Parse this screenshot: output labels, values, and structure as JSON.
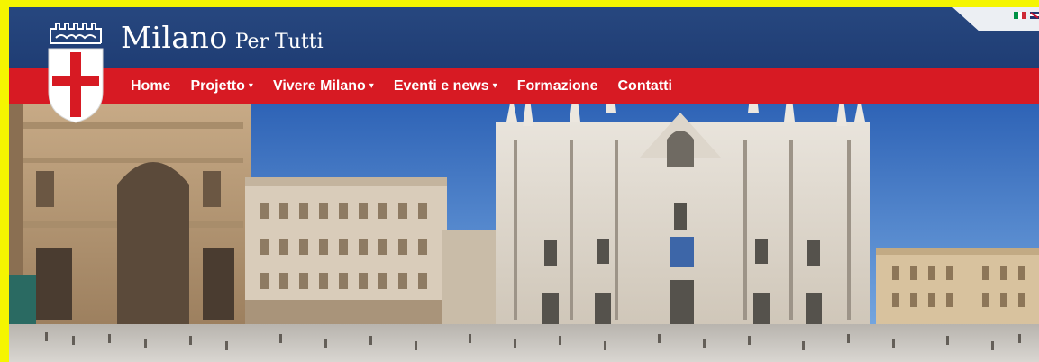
{
  "brand": {
    "name": "Milano",
    "tagline": "Per Tutti"
  },
  "nav": {
    "items": [
      {
        "label": "Home",
        "has_dropdown": false
      },
      {
        "label": "Projetto",
        "has_dropdown": true
      },
      {
        "label": "Vivere Milano",
        "has_dropdown": true
      },
      {
        "label": "Eventi e news",
        "has_dropdown": true
      },
      {
        "label": "Formazione",
        "has_dropdown": false
      },
      {
        "label": "Contatti",
        "has_dropdown": false
      }
    ],
    "caret": "▾"
  },
  "languages": [
    "it-flag-icon",
    "uk-flag-icon"
  ],
  "colors": {
    "header_blue": "#1f3d74",
    "nav_red": "#d71a23",
    "frame_yellow": "#f5f500",
    "sky": "#3b78c8"
  },
  "hero": {
    "icon": "milan-cathedral-photo"
  }
}
